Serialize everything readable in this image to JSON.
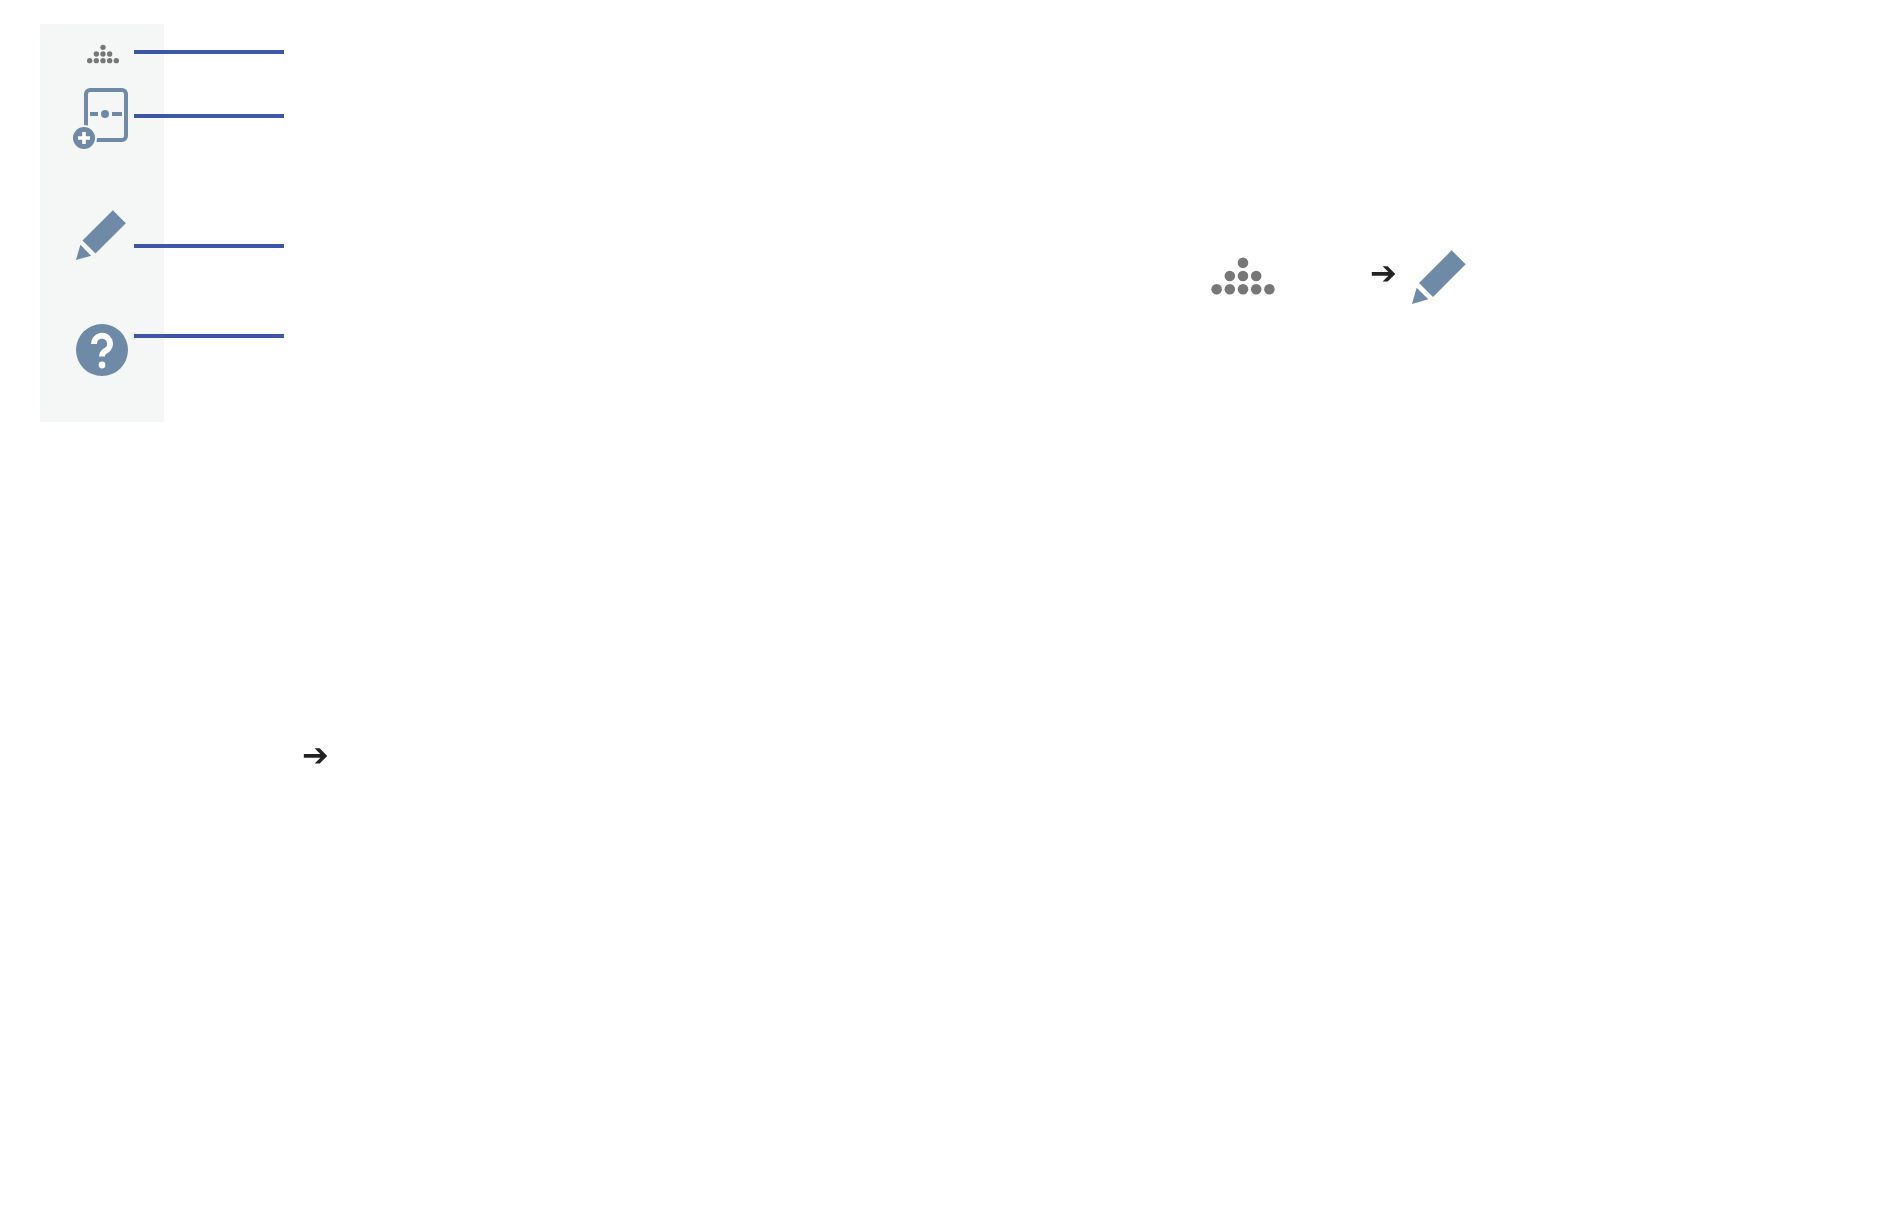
{
  "arrows": [
    "➔",
    "➔"
  ]
}
